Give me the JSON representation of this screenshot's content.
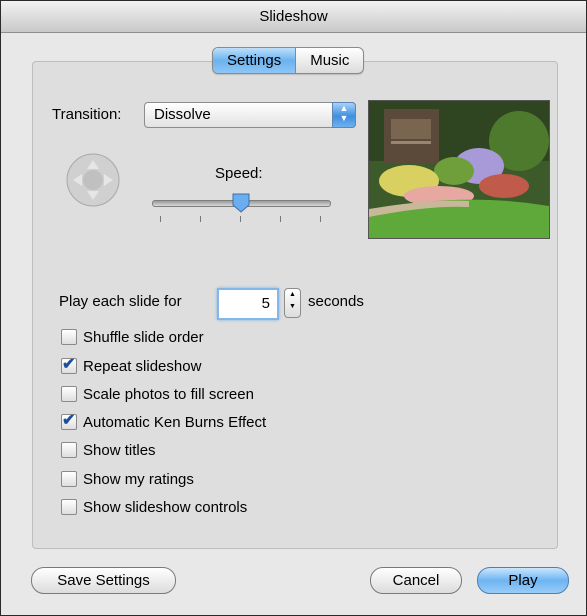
{
  "window": {
    "title": "Slideshow"
  },
  "tabs": [
    {
      "label": "Settings",
      "selected": true
    },
    {
      "label": "Music",
      "selected": false
    }
  ],
  "transition": {
    "label": "Transition:",
    "value": "Dissolve"
  },
  "speed": {
    "label": "Speed:",
    "level": 0.5
  },
  "play_each": {
    "prefix": "Play each slide for",
    "value": "5",
    "suffix": "seconds"
  },
  "options": [
    {
      "label": "Shuffle slide order",
      "checked": false
    },
    {
      "label": "Repeat slideshow",
      "checked": true
    },
    {
      "label": "Scale photos to fill screen",
      "checked": false
    },
    {
      "label": "Automatic Ken Burns Effect",
      "checked": true
    },
    {
      "label": "Show titles",
      "checked": false
    },
    {
      "label": "Show my ratings",
      "checked": false
    },
    {
      "label": "Show slideshow controls",
      "checked": false
    }
  ],
  "buttons": {
    "save": "Save Settings",
    "cancel": "Cancel",
    "play": "Play"
  },
  "icons": {
    "popup": "up-down-arrows-icon",
    "nav": "direction-pad-icon",
    "check": "checkmark-icon"
  },
  "colors": {
    "accent": "#6cb2ef",
    "check": "#1d4fa0"
  }
}
